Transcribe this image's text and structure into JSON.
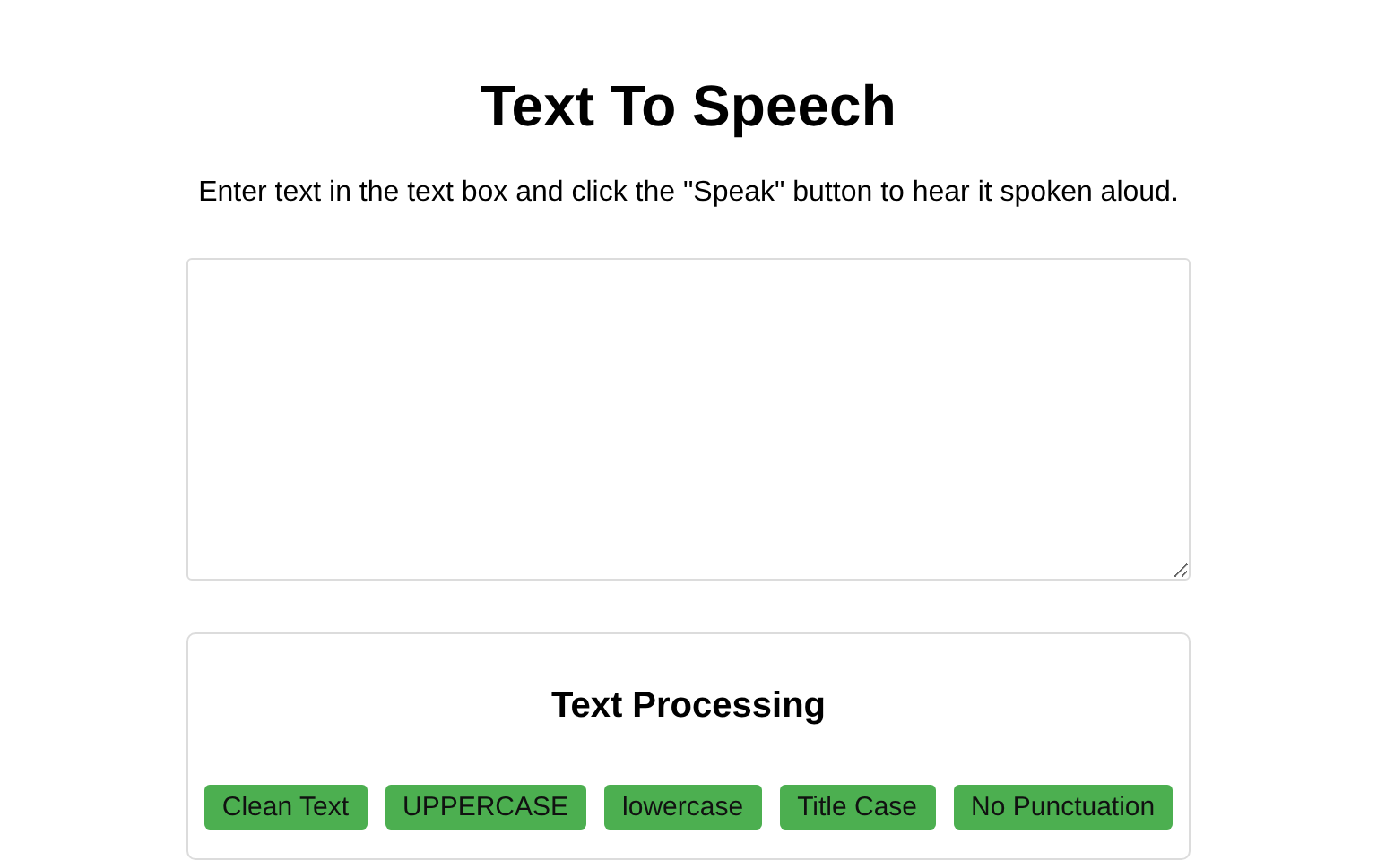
{
  "title": "Text To Speech",
  "instructions": "Enter text in the text box and click the \"Speak\" button to hear it spoken aloud.",
  "processing": {
    "heading": "Text Processing",
    "buttons": [
      "Clean Text",
      "UPPERCASE",
      "lowercase",
      "Title Case",
      "No Punctuation"
    ]
  }
}
